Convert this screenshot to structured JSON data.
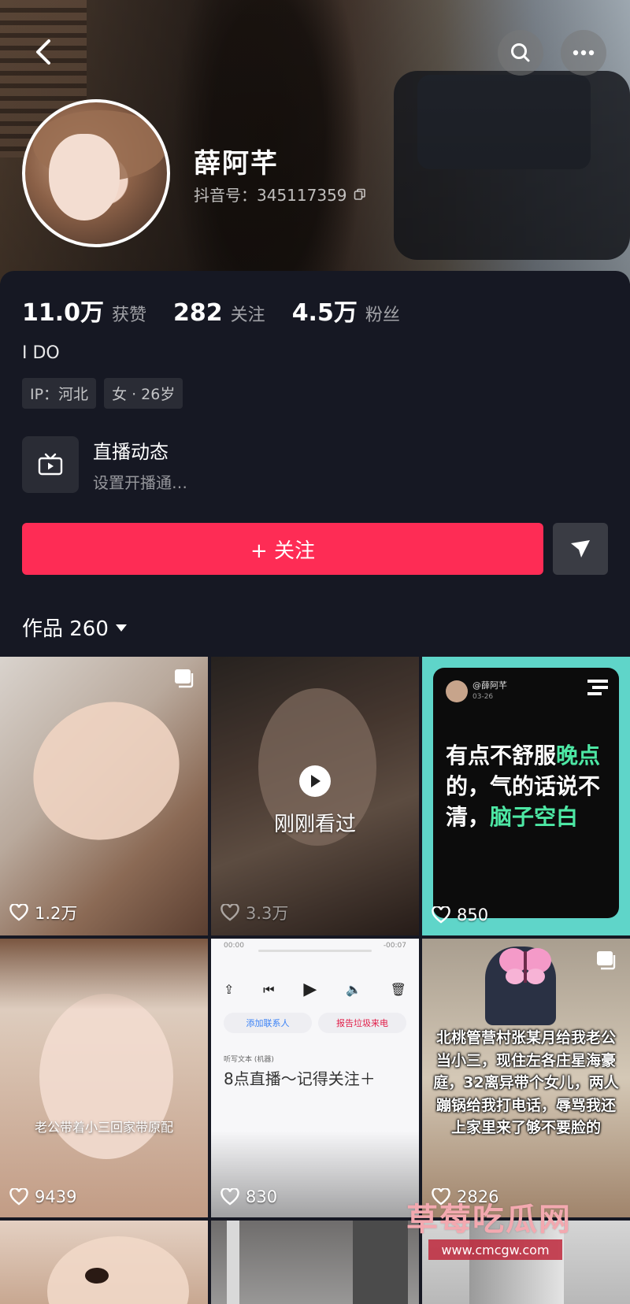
{
  "header": {
    "name": "薛阿芊",
    "douyin_id": "抖音号：345117359"
  },
  "stats": [
    {
      "value": "11.0万",
      "label": "获赞"
    },
    {
      "value": "282",
      "label": "关注"
    },
    {
      "value": "4.5万",
      "label": "粉丝"
    }
  ],
  "bio": "I DO",
  "tags": [
    "IP：河北",
    "女 · 26岁"
  ],
  "live": {
    "title": "直播动态",
    "subtitle": "设置开播通…"
  },
  "follow_button": "+ 关注",
  "works_tab": "作品 260",
  "grid": [
    {
      "likes": "1.2万"
    },
    {
      "likes": "3.3万",
      "overlay": "刚刚看过"
    },
    {
      "likes": "850",
      "post_handle": "@薛阿芊",
      "post_date": "03-26",
      "post_text_a": "有点不舒服",
      "post_text_b": "晚点",
      "post_text_c": "的，气的话说不清，",
      "post_text_d": "脑子空白"
    },
    {
      "likes": "9439",
      "overlay": "老公带着小三回家带原配"
    },
    {
      "likes": "830",
      "time_left": "00:00",
      "time_right": "-00:07",
      "btn_contact": "添加联系人",
      "btn_report": "报告垃圾来电",
      "note": "听写文本 (机器)",
      "overlay": "8点直播～记得关注＋"
    },
    {
      "likes": "2826",
      "overlay": "北桃管营村张某月给我老公当小三，现住左各庄星海豪庭，32离异带个女儿，两人蹦锅给我打电话，辱骂我还上家里来了够不要脸的"
    }
  ],
  "watermark": {
    "title": "草莓吃瓜网",
    "url": "www.cmcgw.com"
  },
  "colors": {
    "accent": "#fe2c55",
    "background": "#161823",
    "green_text": "#4de7a4"
  }
}
